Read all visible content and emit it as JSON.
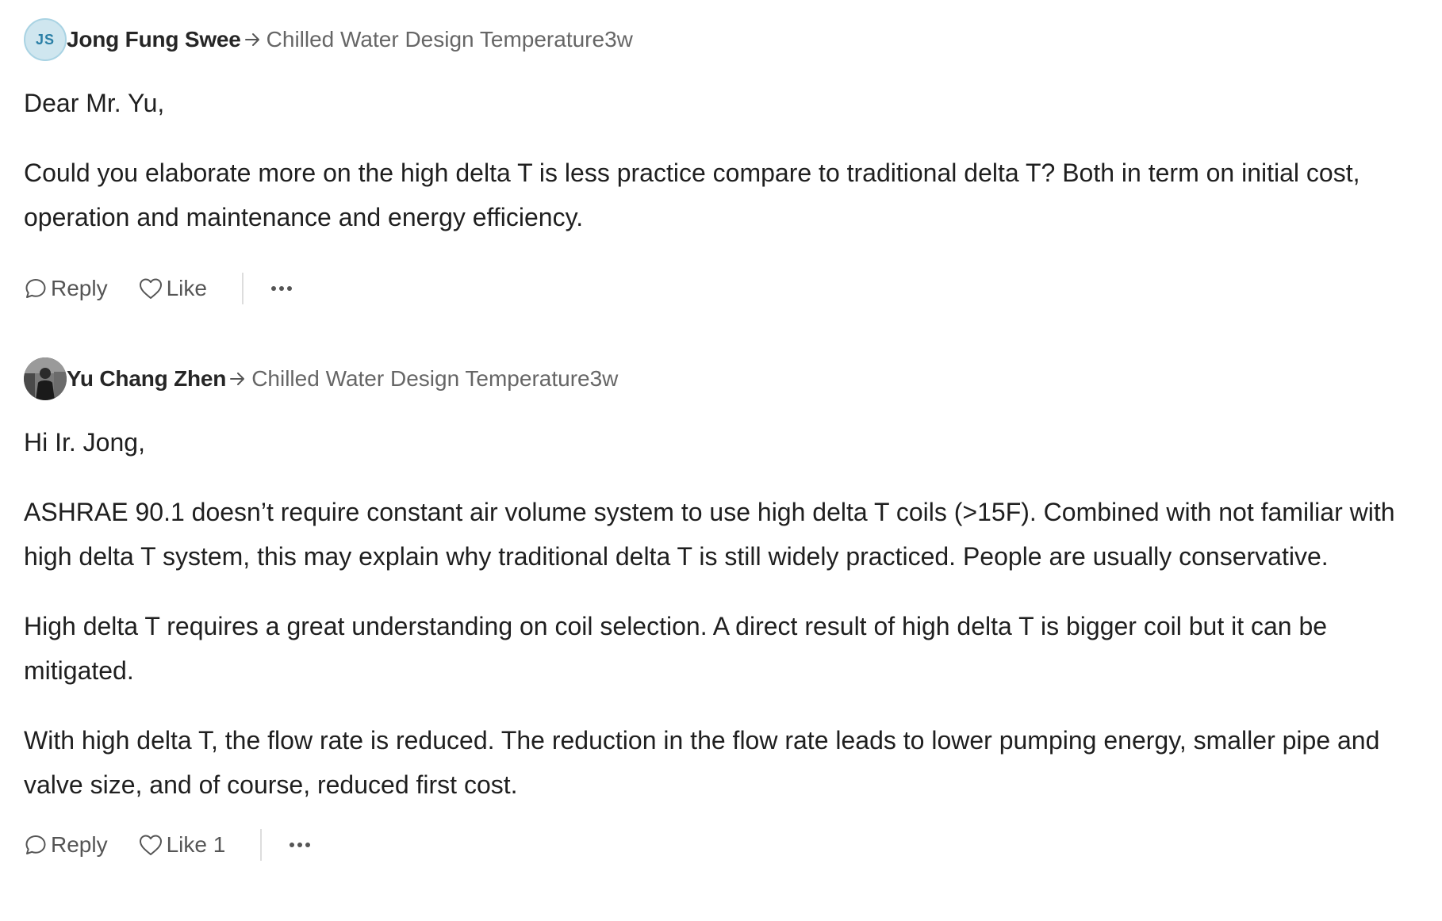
{
  "comments": [
    {
      "author": "Jong Fung Swee",
      "avatar_initials": "JS",
      "topic": "Chilled Water Design Temperature",
      "time": "3w",
      "paragraphs": [
        "Dear Mr. Yu,",
        "Could you elaborate more on the high delta T is less practice compare to traditional delta T? Both in term on initial cost, operation and maintenance and energy efficiency."
      ],
      "actions": {
        "reply_label": "Reply",
        "like_label": "Like",
        "more_icon": "more-horizontal-icon"
      }
    },
    {
      "author": "Yu Chang Zhen",
      "avatar_icon": "user-photo",
      "topic": "Chilled Water Design Temperature",
      "time": "3w",
      "paragraphs": [
        "Hi Ir. Jong,",
        "ASHRAE 90.1 doesn’t require constant air volume system to use high delta T coils (>15F). Combined with not familiar with high delta T system, this may explain why traditional delta T is still widely practiced. People are usually conservative.",
        "High delta T requires a great understanding on coil selection. A direct result of high delta T is bigger coil but it can be mitigated.",
        "With high delta T, the flow rate is reduced. The reduction in the flow rate leads to lower pumping energy, smaller pipe and valve size, and of course, reduced first cost."
      ],
      "actions": {
        "reply_label": "Reply",
        "like_label": "Like 1",
        "more_icon": "more-horizontal-icon"
      }
    }
  ],
  "colors": {
    "text": "#1f1f1f",
    "muted": "#666666",
    "avatar_bg": "#cfe6ef",
    "avatar_text": "#2a7fa6"
  }
}
